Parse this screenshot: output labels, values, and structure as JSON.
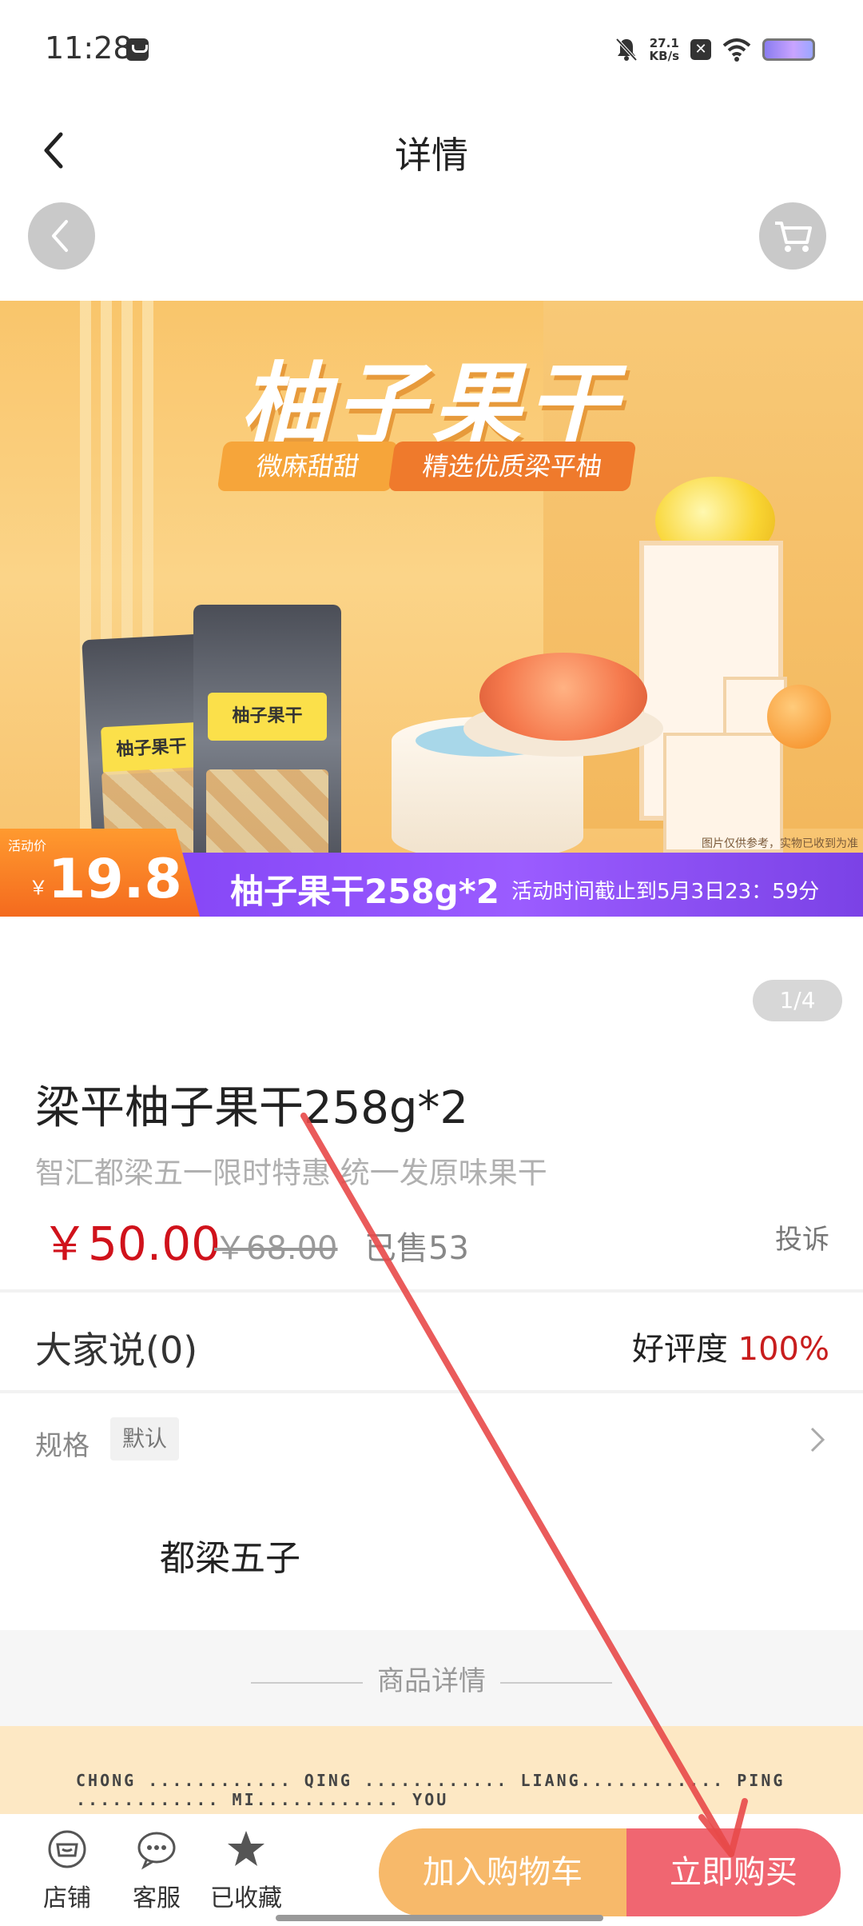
{
  "status_bar": {
    "time": "11:28",
    "net_speed_value": "27.1",
    "net_speed_unit": "KB/s",
    "icons": [
      "message-icon",
      "bell-muted-icon",
      "close-box-icon",
      "wifi-icon",
      "battery-icon"
    ]
  },
  "navbar": {
    "title": "详情"
  },
  "banner": {
    "headline": "柚子果干",
    "tag1": "微麻甜甜",
    "tag2": "精选优质梁平柚",
    "bag_label": "柚子果干",
    "note": "图片仅供参考，实物已收到为准",
    "price_label": "活动价",
    "price_yen": "￥",
    "price_value": "19.8",
    "bar_text": "柚子果干258g*2",
    "bar_text2": "活动时间截止到5月3日23：59分"
  },
  "pager": "1/4",
  "product": {
    "title": "梁平柚子果干258g*2",
    "subtitle": "智汇都梁五一限时特惠 统一发原味果干",
    "price": "￥50.00",
    "old_price": "￥68.00",
    "sold": "已售53",
    "complain": "投诉"
  },
  "reviews": {
    "label": "大家说(0)",
    "rating_label": "好评度",
    "rating_value": "100%"
  },
  "spec": {
    "label": "规格",
    "value": "默认"
  },
  "shop": {
    "name": "都梁五子"
  },
  "details": {
    "title": "商品详情",
    "image_text": "CHONG ............ QING ............ LIANG............ PING ............ MI............ YOU"
  },
  "bottom_bar": {
    "shop_label": "店铺",
    "service_label": "客服",
    "fav_label": "已收藏",
    "cart_button": "加入购物车",
    "buy_button": "立即购买"
  },
  "colors": {
    "price_red": "#d0121b",
    "cart_orange": "#f7b96a",
    "buy_pink": "#f06671",
    "annotation_red": "#e84a4a"
  }
}
